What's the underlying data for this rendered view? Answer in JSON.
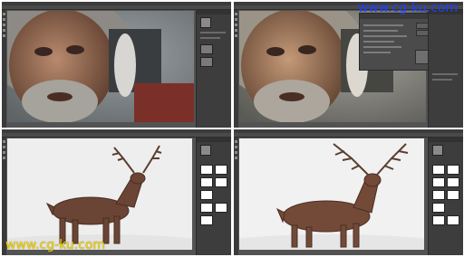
{
  "watermarks": {
    "top_right": "www.cg-ku.com",
    "bottom_left": "www.cg-ku.com"
  },
  "colors": {
    "watermark_top": "#1b3fff",
    "watermark_bottom": "#f2d60a",
    "ps_background": "#535353",
    "ps_panel": "#3d3d3d"
  },
  "panels": [
    {
      "name": "photo-editor-before-portrait",
      "subject": "bearded man in fur hood"
    },
    {
      "name": "photo-editor-after-portrait",
      "subject": "bearded man in fur hood"
    },
    {
      "name": "photo-editor-before-deer",
      "subject": "red deer stag in snow"
    },
    {
      "name": "photo-editor-after-deer",
      "subject": "red deer stag in snow"
    }
  ]
}
